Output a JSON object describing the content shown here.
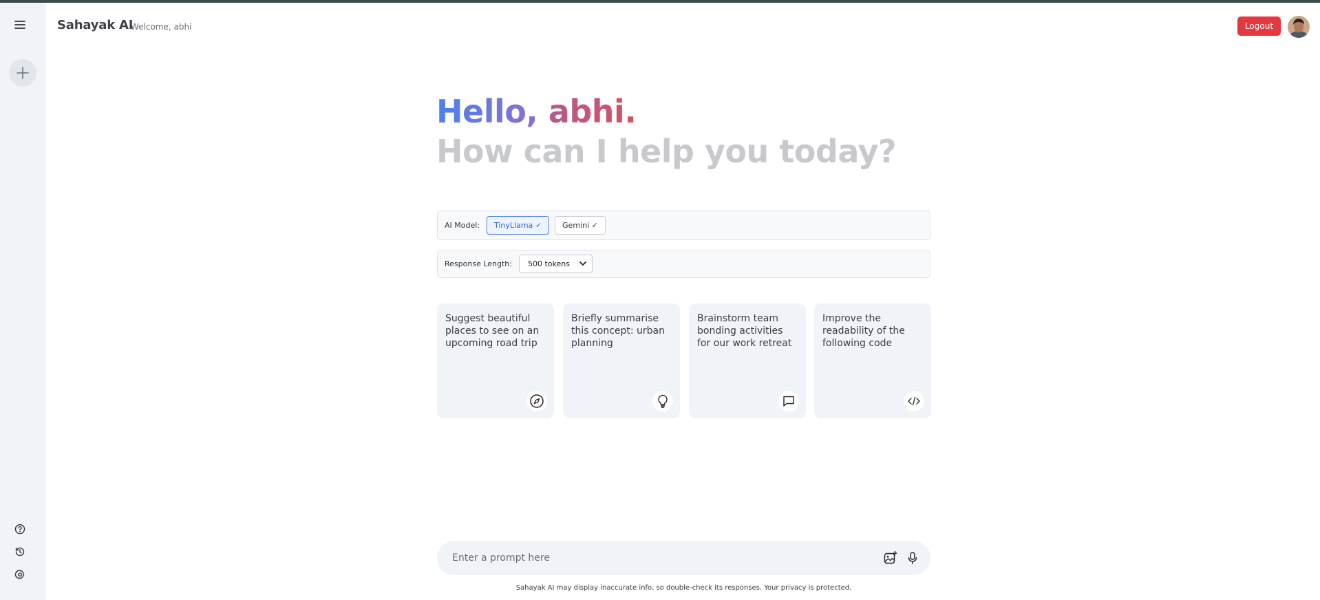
{
  "header": {
    "brand": "Sahayak AI",
    "welcome": "Welcome, abhi",
    "logout_label": "Logout"
  },
  "greeting": {
    "hello": "Hello,",
    "name": "abhi.",
    "subtitle": "How can I help you today?"
  },
  "model_selector": {
    "label": "AI Model:",
    "options": [
      {
        "label": "TinyLlama",
        "check": "✓",
        "active": true
      },
      {
        "label": "Gemini",
        "check": "✓",
        "active": false
      }
    ]
  },
  "response_length": {
    "label": "Response Length:",
    "selected": "500 tokens"
  },
  "cards": [
    {
      "text": "Suggest beautiful places to see on an upcoming road trip",
      "icon": "compass-icon"
    },
    {
      "text": "Briefly summarise this concept: urban planning",
      "icon": "lightbulb-icon"
    },
    {
      "text": "Brainstorm team bonding activities for our work retreat",
      "icon": "chat-bubble-icon"
    },
    {
      "text": "Improve the readability of the following code",
      "icon": "code-icon"
    }
  ],
  "prompt": {
    "placeholder": "Enter a prompt here"
  },
  "disclaimer": "Sahayak AI may display inaccurate info, so double-check its responses. Your privacy is protected.",
  "colors": {
    "logout": "#e5383f",
    "active_model": "#2f63d4",
    "sidebar_bg": "#f0f3f8"
  }
}
